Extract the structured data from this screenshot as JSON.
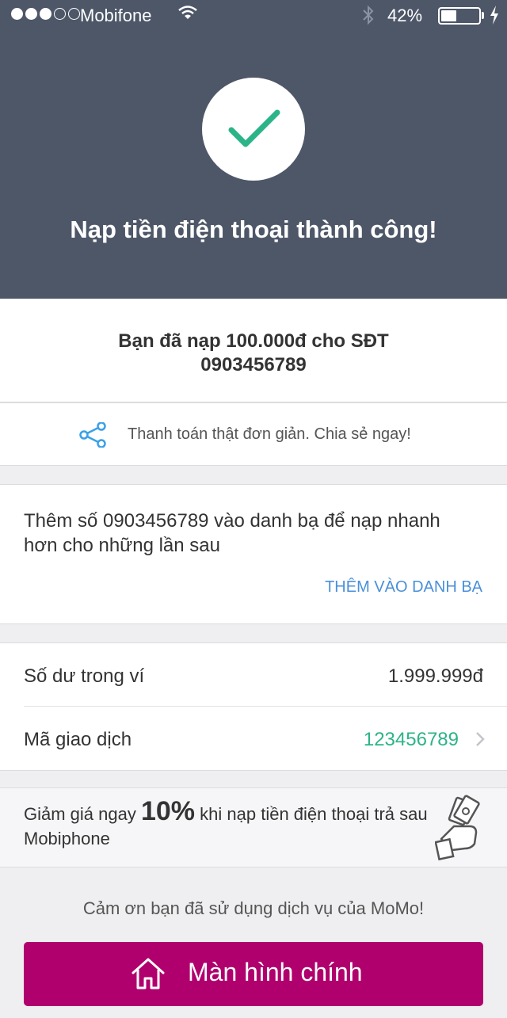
{
  "status_bar": {
    "carrier": "Mobifone",
    "battery_percent": "42%",
    "battery_level": 0.42
  },
  "header": {
    "title": "Nạp tiền điện thoại thành công!"
  },
  "topup": {
    "line1": "Bạn đã nạp 100.000đ cho SĐT",
    "line2": "0903456789"
  },
  "share": {
    "text": "Thanh toán thật đơn giản. Chia sẻ ngay!"
  },
  "contact": {
    "text": "Thêm số 0903456789 vào danh bạ để nạp nhanh hơn cho những lần sau",
    "button": "THÊM VÀO DANH BẠ"
  },
  "info": {
    "balance_label": "Số dư trong ví",
    "balance_value": "1.999.999đ",
    "txn_label": "Mã giao dịch",
    "txn_value": "123456789"
  },
  "promo": {
    "prefix": "Giảm giá ngay",
    "highlight": "10%",
    "suffix": "khi nạp tiền điện thoại trả sau Mobiphone"
  },
  "footer": {
    "thanks": "Cảm ơn bạn đã sử dụng dịch vụ của MoMo!",
    "home_button": "Màn hình chính"
  },
  "colors": {
    "header_bg": "#4e5768",
    "accent_green": "#2cb489",
    "link_blue": "#4a90d9",
    "button_magenta": "#b0006d"
  }
}
